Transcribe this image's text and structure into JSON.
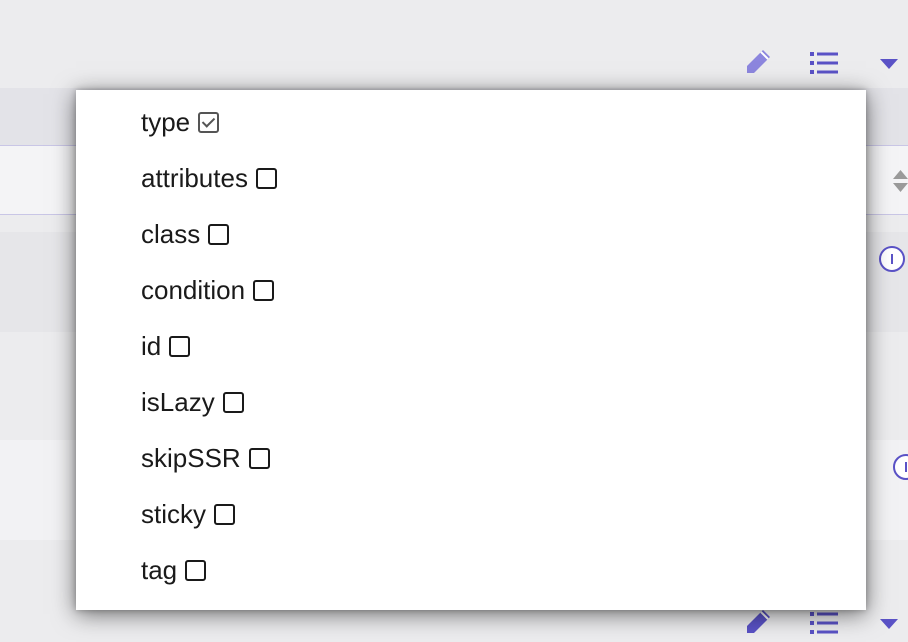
{
  "toolbar": {
    "icons": [
      "pencil-icon",
      "list-icon",
      "caret-down-icon"
    ],
    "accent_color": "#5a52c6",
    "pencil_color": "#8c86de"
  },
  "column_menu": {
    "options": [
      {
        "label": "type",
        "checked": true
      },
      {
        "label": "attributes",
        "checked": false
      },
      {
        "label": "class",
        "checked": false
      },
      {
        "label": "condition",
        "checked": false
      },
      {
        "label": "id",
        "checked": false
      },
      {
        "label": "isLazy",
        "checked": false
      },
      {
        "label": "skipSSR",
        "checked": false
      },
      {
        "label": "sticky",
        "checked": false
      },
      {
        "label": "tag",
        "checked": false
      }
    ]
  }
}
